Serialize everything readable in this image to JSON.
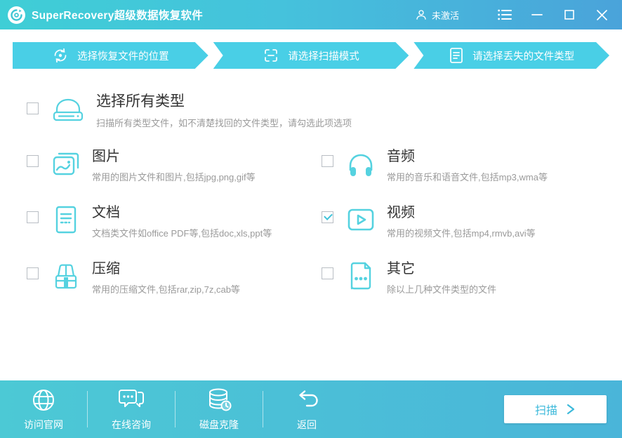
{
  "titlebar": {
    "app_title": "SuperRecovery超级数据恢复软件",
    "activation_status": "未激活"
  },
  "steps": [
    {
      "label": "选择恢复文件的位置",
      "icon": "recover-location-icon"
    },
    {
      "label": "请选择扫描模式",
      "icon": "scan-mode-icon"
    },
    {
      "label": "请选择丢失的文件类型",
      "icon": "file-type-icon"
    }
  ],
  "select_all": {
    "title": "选择所有类型",
    "description": "扫描所有类型文件，如不清楚找回的文件类型，请勾选此项选项",
    "checked": false,
    "icon": "drive-icon"
  },
  "file_types": [
    {
      "title": "图片",
      "description": "常用的图片文件和图片,包括jpg,png,gif等",
      "checked": false,
      "icon": "image-icon"
    },
    {
      "title": "音频",
      "description": "常用的音乐和语音文件,包括mp3,wma等",
      "checked": false,
      "icon": "audio-icon"
    },
    {
      "title": "文档",
      "description": "文档类文件如office PDF等,包括doc,xls,ppt等",
      "checked": false,
      "icon": "document-icon"
    },
    {
      "title": "视频",
      "description": "常用的视频文件,包括mp4,rmvb,avi等",
      "checked": true,
      "icon": "video-icon"
    },
    {
      "title": "压缩",
      "description": "常用的压缩文件,包括rar,zip,7z,cab等",
      "checked": false,
      "icon": "archive-icon"
    },
    {
      "title": "其它",
      "description": "除以上几种文件类型的文件",
      "checked": false,
      "icon": "other-icon"
    }
  ],
  "footer": {
    "actions": [
      {
        "label": "访问官网",
        "icon": "globe-icon"
      },
      {
        "label": "在线咨询",
        "icon": "chat-icon"
      },
      {
        "label": "磁盘克隆",
        "icon": "disk-clone-icon"
      },
      {
        "label": "返回",
        "icon": "return-icon"
      }
    ],
    "scan_label": "扫描"
  },
  "colors": {
    "titlebar_gradient_start": "#3fced6",
    "titlebar_gradient_end": "#4aa3da",
    "step_arrow": "#49cfe6",
    "footer_gradient_start": "#4cc9d5",
    "footer_gradient_end": "#4ab5d9",
    "type_icon_accent": "#55d2e0",
    "check_accent": "#3fc3da",
    "title_text": "#333333",
    "description_text": "#9a9a9a",
    "scan_button_text": "#3cb9da"
  }
}
